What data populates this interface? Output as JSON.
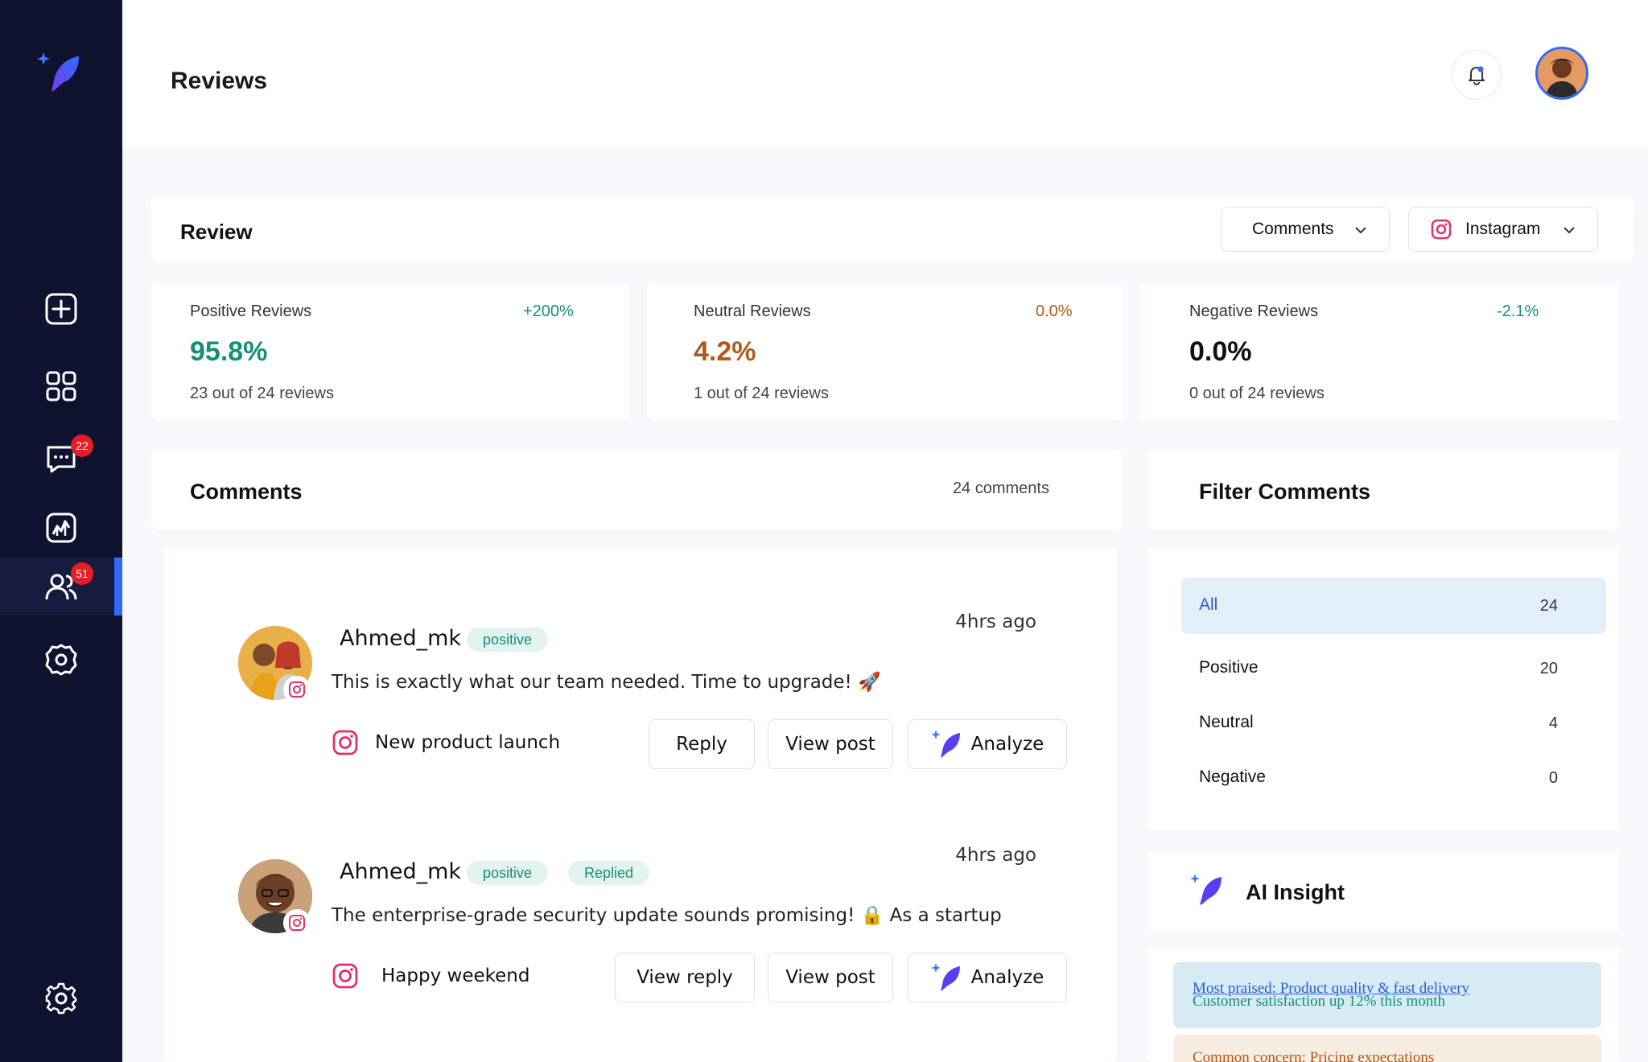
{
  "header": {
    "title": "Reviews"
  },
  "sidebar": {
    "messages_badge": "22",
    "audience_badge": "51"
  },
  "review": {
    "title": "Review",
    "type_dropdown": "Comments",
    "platform_dropdown": "Instagram"
  },
  "stats": [
    {
      "label": "Positive Reviews",
      "change": "+200%",
      "value": "95.8%",
      "sub": "23 out of 24 reviews",
      "color": "#129177",
      "change_color": "#129177"
    },
    {
      "label": "Neutral Reviews",
      "change": "0.0%",
      "value": "4.2%",
      "sub": "1 out of 24 reviews",
      "color": "#b15a1a",
      "change_color": "#b15a1a"
    },
    {
      "label": "Negative Reviews",
      "change": "-2.1%",
      "value": "0.0%",
      "sub": "0 out of 24 reviews",
      "color": "#111111",
      "change_color": "#129177"
    }
  ],
  "comments": {
    "title": "Comments",
    "count": "24 comments",
    "items": [
      {
        "name": "Ahmed_mk",
        "badges": [
          "positive"
        ],
        "time": "4hrs ago",
        "text": "This is exactly what our team needed. Time to upgrade! 🚀",
        "post": "New product launch",
        "buttons": [
          "Reply",
          "View post",
          "Analyze"
        ]
      },
      {
        "name": "Ahmed_mk",
        "badges": [
          "positive",
          "Replied"
        ],
        "time": "4hrs ago",
        "text": "The enterprise-grade security update sounds promising! 🔒 As a startup",
        "post": "Happy weekend",
        "buttons": [
          "View reply",
          "View post",
          "Analyze"
        ]
      }
    ]
  },
  "filter": {
    "title": "Filter Comments",
    "rows": [
      {
        "label": "All",
        "count": "24"
      },
      {
        "label": "Positive",
        "count": "20"
      },
      {
        "label": "Neutral",
        "count": "4"
      },
      {
        "label": "Negative",
        "count": "0"
      }
    ]
  },
  "ai": {
    "title": "AI Insight",
    "card1_line1": "Most praised: Product quality & fast delivery",
    "card1_line2": "Customer satisfaction up 12% this month",
    "card2_line1": "Common concern: Pricing expectations"
  },
  "icons": {
    "logo": "feather-logo-icon",
    "create": "plus-square-icon",
    "dashboard": "grid-icon",
    "messages": "chat-icon",
    "analytics": "chart-icon",
    "audience": "users-icon",
    "settings_top": "gear-outline-icon",
    "settings_bottom": "settings-icon",
    "notifications": "bell-icon",
    "instagram": "instagram-icon",
    "analyze": "feather-sparkle-icon"
  },
  "colors": {
    "sidebar_bg": "#0f1330",
    "accent_blue": "#2f6bff",
    "positive_green": "#129177",
    "neutral_orange": "#b15a1a",
    "instagram_red": "#e1306c",
    "badge_red": "#e41e26"
  }
}
